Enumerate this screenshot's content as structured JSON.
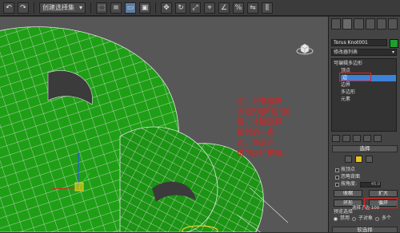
{
  "toolbar": {
    "selection_filter": "创建选择集",
    "buttons": [
      "undo-icon",
      "redo-icon",
      "link-icon",
      "unlink-icon",
      "bind-icon",
      "select-icon",
      "select-name-icon",
      "rect-region-icon",
      "window-icon",
      "move-icon",
      "rotate-icon",
      "scale-icon",
      "snap-icon",
      "angle-snap-icon",
      "percent-snap-icon",
      "mirror-icon",
      "align-icon"
    ]
  },
  "viewport": {
    "annotation": "注：只有编辑多边形的\"边\"层级，才能选择相邻的一条边，然后点击\"循环\"按钮。",
    "mesh_color": "#1f9f16",
    "wire_color": "#e6e6e6"
  },
  "panel": {
    "object_name": "Torus Knot001",
    "object_color": "#1fa02a",
    "modifier_list": "修改器列表",
    "stack": {
      "root": "可编辑多边形",
      "items": [
        "顶点",
        "边",
        "边界",
        "多边形",
        "元素"
      ],
      "selected_index": 1
    },
    "selection_rollout": "选择",
    "checkbox_backface": "按顶点",
    "checkbox_ignore_backface": "忽略背面",
    "angle_label": "按角度:",
    "angle_value": "45.0",
    "shrink": "收缩",
    "grow": "扩大",
    "ring": "环形",
    "loop": "循环",
    "preview_selection": "预览选择",
    "preview_off": "禁用",
    "preview_subobj": "子对象",
    "preview_multi": "多个",
    "status": "选择了边 100",
    "soft_selection": "软选择"
  }
}
